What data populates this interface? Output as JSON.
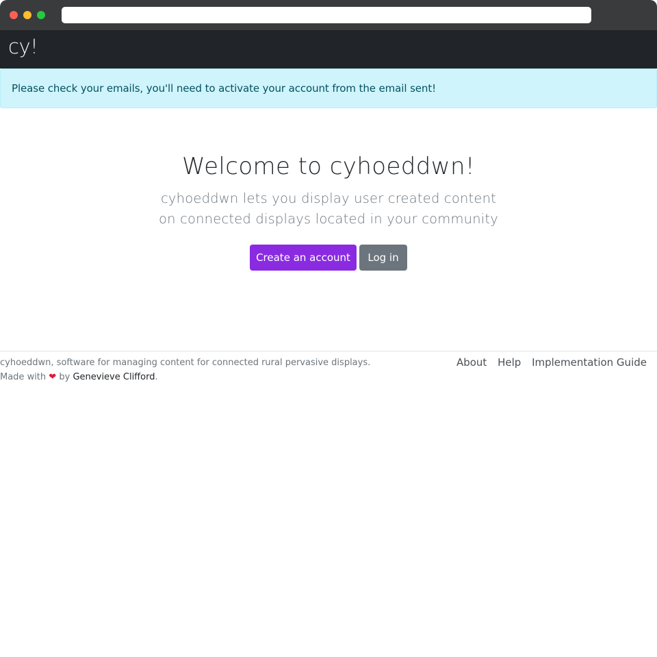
{
  "browser": {
    "url": ""
  },
  "navbar": {
    "brand": "cy!"
  },
  "alert": {
    "message": "Please check your emails, you'll need to activate your account from the email sent!",
    "colors": {
      "background": "#cff4fc",
      "text": "#055160"
    }
  },
  "hero": {
    "title": "Welcome to cyhoeddwn!",
    "subtitle_line1": "cyhoeddwn lets you display user created content",
    "subtitle_line2": "on connected displays located in your community",
    "create_account_label": "Create an account",
    "login_label": "Log in",
    "colors": {
      "primary": "#8a2be2",
      "secondary": "#6c757d"
    }
  },
  "footer": {
    "description": "cyhoeddwn, software for managing content for connected rural pervasive displays.",
    "made_with": "Made with",
    "heart_icon": "heart-icon",
    "by": "by",
    "author": "Genevieve Clifford",
    "period": ".",
    "links": [
      {
        "label": "About"
      },
      {
        "label": "Help"
      },
      {
        "label": "Implementation Guide"
      }
    ]
  }
}
